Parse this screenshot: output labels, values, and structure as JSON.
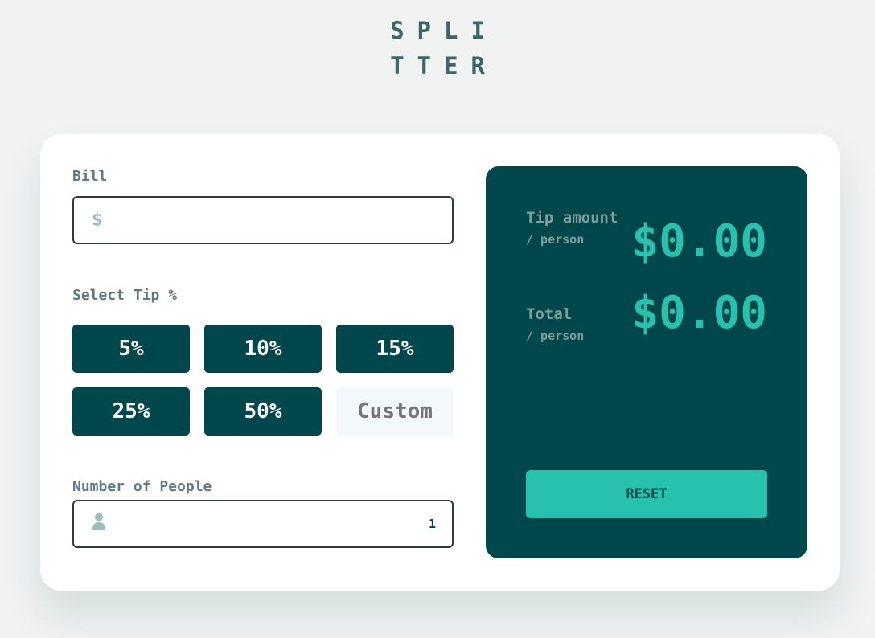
{
  "logo": {
    "line1": "SPLI",
    "line2": "TTER"
  },
  "bill": {
    "label": "Bill",
    "currency_symbol": "$",
    "value": ""
  },
  "tip": {
    "label": "Select Tip %",
    "options": [
      "5%",
      "10%",
      "15%",
      "25%",
      "50%"
    ],
    "custom_placeholder": "Custom"
  },
  "people": {
    "label": "Number of People",
    "value": "1",
    "icon": "person-icon"
  },
  "results": {
    "tip_label": "Tip amount",
    "tip_sub": "/ person",
    "tip_value": "$0.00",
    "total_label": "Total",
    "total_sub": "/ person",
    "total_value": "$0.00",
    "reset_label": "RESET"
  },
  "colors": {
    "dark_green": "#00474b",
    "accent": "#26c2ad",
    "background": "#f1f2f2"
  }
}
